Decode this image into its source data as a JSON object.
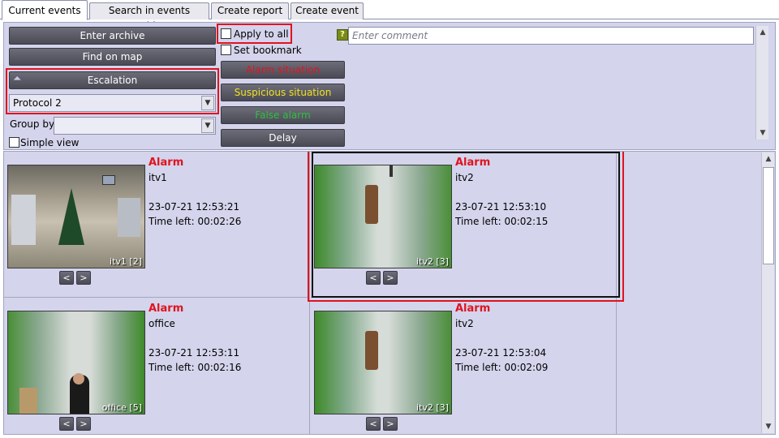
{
  "tabs": [
    {
      "label": "Current events"
    },
    {
      "label": "Search in events archive"
    },
    {
      "label": "Create report"
    },
    {
      "label": "Create event"
    }
  ],
  "left_panel": {
    "enter_archive": "Enter archive",
    "find_on_map": "Find on map",
    "escalation": "Escalation",
    "protocol_value": "Protocol 2",
    "group_by_label": "Group by:",
    "group_by_value": "",
    "simple_view_label": "Simple view"
  },
  "actions": {
    "apply_to_all": "Apply to all",
    "set_bookmark": "Set bookmark",
    "alarm_situation": "Alarm situation",
    "suspicious_situation": "Suspicious situation",
    "false_alarm": "False alarm",
    "delay": "Delay"
  },
  "comment": {
    "placeholder": "Enter comment",
    "help_icon_text": "?"
  },
  "colors": {
    "alarm_red": "#e0141e",
    "suspicious_yellow": "#f0e020",
    "false_alarm_green": "#2ec040",
    "highlight_red": "#e0141e"
  },
  "events": [
    {
      "type": "Alarm",
      "camera": "itv1",
      "timestamp": "23-07-21 12:53:21",
      "time_left": "Time left: 00:02:26",
      "thumb_label": "itv1 [2]"
    },
    {
      "type": "Alarm",
      "camera": "itv2",
      "timestamp": "23-07-21 12:53:10",
      "time_left": "Time left: 00:02:15",
      "thumb_label": "itv2 [3]"
    },
    {
      "type": "Alarm",
      "camera": "office",
      "timestamp": "23-07-21 12:53:11",
      "time_left": "Time left: 00:02:16",
      "thumb_label": "office [5]"
    },
    {
      "type": "Alarm",
      "camera": "itv2",
      "timestamp": "23-07-21 12:53:04",
      "time_left": "Time left: 00:02:09",
      "thumb_label": "itv2 [3]"
    }
  ],
  "nav": {
    "prev": "<",
    "next": ">"
  },
  "icons": {
    "collapse": "chevron-up-icon",
    "dropdown": "chevron-down-icon",
    "scroll_up": "scroll-up-icon",
    "scroll_down": "scroll-down-icon",
    "help": "help-icon"
  }
}
